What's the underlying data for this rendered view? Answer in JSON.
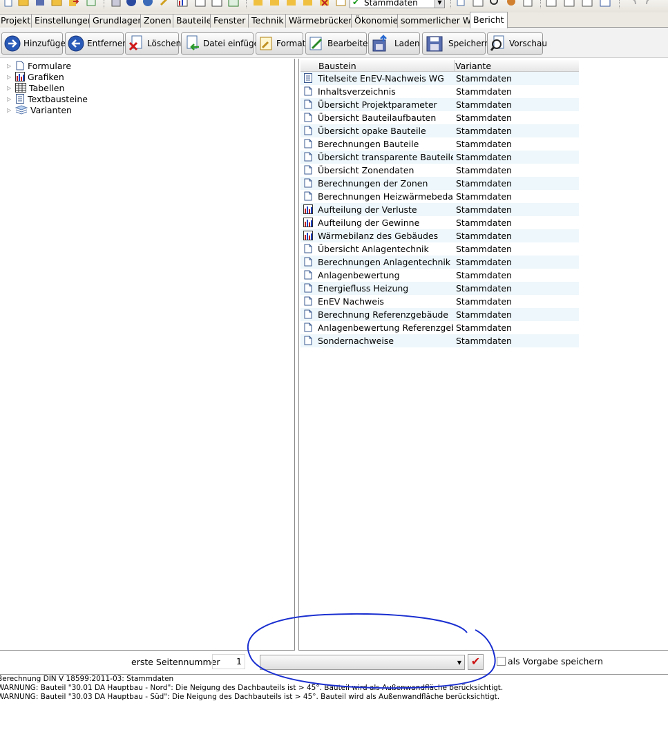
{
  "toolbar": {
    "variant_value": "Stammdaten"
  },
  "tabs": [
    {
      "label": "Projekt"
    },
    {
      "label": "Einstellungen"
    },
    {
      "label": "Grundlagen"
    },
    {
      "label": "Zonen"
    },
    {
      "label": "Bauteile"
    },
    {
      "label": "Fenster"
    },
    {
      "label": "Technik"
    },
    {
      "label": "Wärmebrücken"
    },
    {
      "label": "Ökonomie"
    },
    {
      "label": "sommerlicher WS"
    },
    {
      "label": "Bericht"
    }
  ],
  "actions": [
    {
      "label": "Hinzufügen"
    },
    {
      "label": "Entfernen"
    },
    {
      "label": "Löschen"
    },
    {
      "label": "Datei einfügen"
    },
    {
      "label": "Format"
    },
    {
      "label": "Bearbeiten"
    },
    {
      "label": "Laden"
    },
    {
      "label": "Speichern"
    },
    {
      "label": "Vorschau"
    }
  ],
  "tree": [
    {
      "label": "Formulare"
    },
    {
      "label": "Grafiken"
    },
    {
      "label": "Tabellen"
    },
    {
      "label": "Textbausteine"
    },
    {
      "label": "Varianten"
    }
  ],
  "list": {
    "header": {
      "baustein": "Baustein",
      "variante": "Variante"
    },
    "rows": [
      {
        "name": "Titelseite EnEV-Nachweis WG",
        "variant": "Stammdaten",
        "icon": "text-document-icon"
      },
      {
        "name": "Inhaltsverzeichnis",
        "variant": "Stammdaten",
        "icon": "document-icon"
      },
      {
        "name": "Übersicht Projektparameter",
        "variant": "Stammdaten",
        "icon": "document-icon"
      },
      {
        "name": "Übersicht Bauteilaufbauten",
        "variant": "Stammdaten",
        "icon": "document-icon"
      },
      {
        "name": "Übersicht opake Bauteile",
        "variant": "Stammdaten",
        "icon": "document-icon"
      },
      {
        "name": "Berechnungen Bauteile",
        "variant": "Stammdaten",
        "icon": "document-icon"
      },
      {
        "name": "Übersicht transparente Bauteile",
        "variant": "Stammdaten",
        "icon": "document-icon"
      },
      {
        "name": "Übersicht Zonendaten",
        "variant": "Stammdaten",
        "icon": "document-icon"
      },
      {
        "name": "Berechnungen der Zonen",
        "variant": "Stammdaten",
        "icon": "document-icon"
      },
      {
        "name": "Berechnungen Heizwärmebedarf",
        "variant": "Stammdaten",
        "icon": "document-icon"
      },
      {
        "name": "Aufteilung der Verluste",
        "variant": "Stammdaten",
        "icon": "chart-icon"
      },
      {
        "name": "Aufteilung der Gewinne",
        "variant": "Stammdaten",
        "icon": "chart-icon"
      },
      {
        "name": "Wärmebilanz des Gebäudes",
        "variant": "Stammdaten",
        "icon": "chart-icon"
      },
      {
        "name": "Übersicht Anlagentechnik",
        "variant": "Stammdaten",
        "icon": "document-icon"
      },
      {
        "name": "Berechnungen Anlagentechnik",
        "variant": "Stammdaten",
        "icon": "document-icon"
      },
      {
        "name": "Anlagenbewertung",
        "variant": "Stammdaten",
        "icon": "document-icon"
      },
      {
        "name": "Energiefluss Heizung",
        "variant": "Stammdaten",
        "icon": "document-icon"
      },
      {
        "name": "EnEV Nachweis",
        "variant": "Stammdaten",
        "icon": "document-icon"
      },
      {
        "name": "Berechnung Referenzgebäude",
        "variant": "Stammdaten",
        "icon": "document-icon"
      },
      {
        "name": "Anlagenbewertung Referenzgebä...",
        "variant": "Stammdaten",
        "icon": "document-icon"
      },
      {
        "name": "Sondernachweise",
        "variant": "Stammdaten",
        "icon": "document-icon"
      }
    ]
  },
  "bottom": {
    "start_page_label": "erste Seitennummer",
    "start_page_value": "1",
    "template_value": "",
    "save_default_label": "als Vorgabe speichern"
  },
  "log": [
    "Berechnung DIN V 18599:2011-03: Stammdaten",
    "WARNUNG: Bauteil \"30.01 DA Hauptbau - Nord\": Die Neigung des Dachbauteils ist > 45°. Bauteil wird als Außenwandfläche berücksichtigt.",
    "WARNUNG: Bauteil \"30.03 DA Hauptbau - Süd\": Die Neigung des Dachbauteils ist > 45°. Bauteil wird als Außenwandfläche berücksichtigt."
  ],
  "colors": {
    "annotation_stroke": "#1a2fd0",
    "row_alt": "#eef7fb",
    "ok_check": "#cc1010"
  }
}
